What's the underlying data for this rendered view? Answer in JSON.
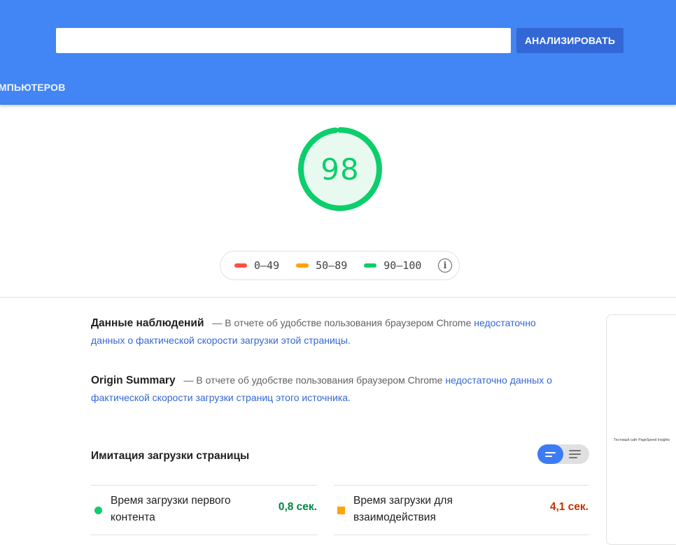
{
  "header": {
    "url_value": "",
    "analyze_label": "АНАЛИЗИРОВАТЬ",
    "device_tab_label": "КОМПЬЮТЕРОВ"
  },
  "score": {
    "value": "98",
    "fraction": 0.98,
    "color": "#0cce6b"
  },
  "legend": {
    "items": [
      {
        "range": "0–49",
        "color": "#ff4e42"
      },
      {
        "range": "50–89",
        "color": "#ffa400"
      },
      {
        "range": "90–100",
        "color": "#0cce6b"
      }
    ],
    "info_icon": "info-icon"
  },
  "field_data": {
    "title": "Данные наблюдений",
    "text": "— В отчете об удобстве пользования браузером Chrome",
    "link": "недостаточно данных о фактической скорости загрузки этой страницы."
  },
  "origin_summary": {
    "title": "Origin Summary",
    "text": "— В отчете об удобстве пользования браузером Chrome",
    "link": "недостаточно данных о фактической скорости загрузки страниц этого источника."
  },
  "lab": {
    "title": "Имитация загрузки страницы",
    "metrics": [
      {
        "label": "Время загрузки первого контента",
        "value": "0,8 сек.",
        "color": "#018642"
      },
      {
        "label": "Время загрузки для взаимодействия",
        "value": "4,1 сек.",
        "color": "#c33300"
      }
    ]
  },
  "screenshot": {
    "caption": "Тестовый сайт PageSpeed Insights"
  }
}
